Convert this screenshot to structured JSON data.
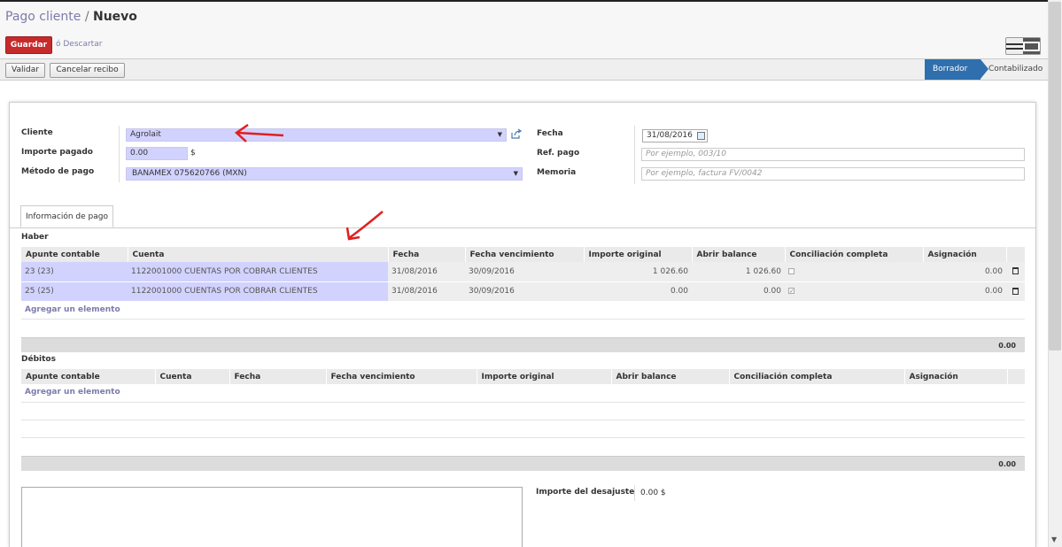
{
  "breadcrumb": {
    "parent": "Pago cliente",
    "separator": " / ",
    "current": "Nuevo"
  },
  "actions": {
    "save": "Guardar",
    "discard": "ó Descartar"
  },
  "statusbar": {
    "buttons": [
      "Validar",
      "Cancelar recibo"
    ],
    "states": {
      "draft": "Borrador",
      "posted": "Contabilizado"
    }
  },
  "form": {
    "customer_label": "Cliente",
    "customer_value": "Agrolait",
    "amount_label": "Importe pagado",
    "amount_value": "0.00",
    "currency": "$",
    "method_label": "Método de pago",
    "method_value": "BANAMEX 075620766 (MXN)",
    "date_label": "Fecha",
    "date_value": "31/08/2016",
    "ref_label": "Ref. pago",
    "ref_placeholder": "Por ejemplo, 003/10",
    "memo_label": "Memoria",
    "memo_placeholder": "Por ejemplo, factura FV/0042"
  },
  "tabs": [
    "Información de pago"
  ],
  "credits": {
    "title": "Haber",
    "columns": [
      "Apunte contable",
      "Cuenta",
      "Fecha",
      "Fecha vencimiento",
      "Importe original",
      "Abrir balance",
      "Conciliación completa",
      "Asignación"
    ],
    "rows": [
      {
        "entry": "23 (23)",
        "account": "1122001000 CUENTAS POR COBRAR CLIENTES",
        "date": "31/08/2016",
        "due": "30/09/2016",
        "original": "1 026.60",
        "open": "1 026.60",
        "reconciled": false,
        "allocation": "0.00"
      },
      {
        "entry": "25 (25)",
        "account": "1122001000 CUENTAS POR COBRAR CLIENTES",
        "date": "31/08/2016",
        "due": "30/09/2016",
        "original": "0.00",
        "open": "0.00",
        "reconciled": true,
        "allocation": "0.00"
      }
    ],
    "add_item": "Agregar un elemento",
    "total": "0.00"
  },
  "debits": {
    "title": "Débitos",
    "columns": [
      "Apunte contable",
      "Cuenta",
      "Fecha",
      "Fecha vencimiento",
      "Importe original",
      "Abrir balance",
      "Conciliación completa",
      "Asignación"
    ],
    "add_item": "Agregar un elemento",
    "total": "0.00"
  },
  "writeoff": {
    "label": "Importe del desajuste",
    "value": "0.00 $"
  },
  "colors": {
    "brand": "#7c7bad",
    "save": "#c62a2a",
    "active_state": "#2f6fad",
    "required_field": "#d2d2ff"
  },
  "icons": [
    "external-link-icon",
    "calendar-icon",
    "trash-icon",
    "list-view-icon",
    "form-view-icon",
    "red-arrow-annotation"
  ]
}
